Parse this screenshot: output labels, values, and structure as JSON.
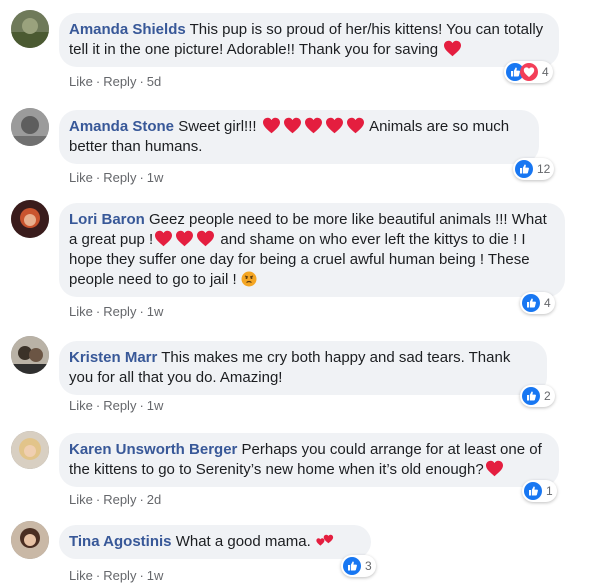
{
  "comments": [
    {
      "name": "Amanda Shields",
      "text": "This pup is so proud of her/his kittens! You can totally tell it in the one picture! Adorable!! Thank you for saving",
      "like": "Like",
      "reply": "Reply",
      "time": "5d",
      "reactions": [
        "like-icon",
        "love-icon"
      ],
      "count": "4"
    },
    {
      "name": "Amanda Stone",
      "text_a": "Sweet girl!!!",
      "text_b": "Animals are so much better than humans.",
      "like": "Like",
      "reply": "Reply",
      "time": "1w",
      "reactions": [
        "like-icon"
      ],
      "count": "12"
    },
    {
      "name": "Lori Baron",
      "text_a": "Geez people need to be more like beautiful animals !!! What a great pup !",
      "text_b": "and shame on who ever left the kittys to die ! I hope they suffer one day for being a cruel awful human being ! These people need to go to jail !",
      "like": "Like",
      "reply": "Reply",
      "time": "1w",
      "reactions": [
        "like-icon"
      ],
      "count": "4"
    },
    {
      "name": "Kristen Marr",
      "text": "This makes me cry both happy and sad tears. Thank you for all that you do. Amazing!",
      "like": "Like",
      "reply": "Reply",
      "time": "1w",
      "reactions": [
        "like-icon"
      ],
      "count": "2"
    },
    {
      "name": "Karen Unsworth Berger",
      "text": "Perhaps you could arrange for at least one of the kittens to go to Serenity’s new home when it’s old enough?",
      "like": "Like",
      "reply": "Reply",
      "time": "2d",
      "reactions": [
        "like-icon"
      ],
      "count": "1"
    },
    {
      "name": "Tina Agostinis",
      "text": "What a good mama.",
      "like": "Like",
      "reply": "Reply",
      "time": "1w",
      "reactions": [
        "like-icon"
      ],
      "count": "3"
    }
  ],
  "colors": {
    "name": "#385898",
    "bubble": "#f0f2f5",
    "meta": "#65676b",
    "like_blue": "#1877f2",
    "heart_red": "#e41e3f"
  }
}
